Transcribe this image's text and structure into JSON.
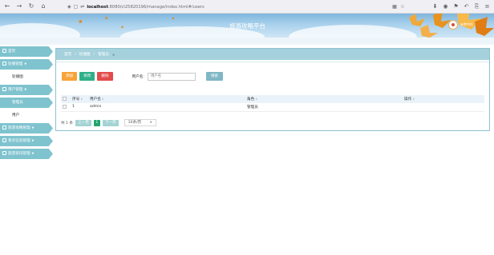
{
  "browser": {
    "back_icon": "arrow-left-icon",
    "forward_icon": "arrow-right-icon",
    "reload_icon": "reload-icon",
    "home_icon": "home-icon",
    "url_host": "localhost",
    "url_port_path": ":8080/cl25820196/manage/index.html#/users",
    "toolbar_icons": [
      "extensions-icon",
      "account-icon",
      "bookmark-icon",
      "undo-icon",
      "screenshot-icon",
      "menu-icon"
    ]
  },
  "header": {
    "title": "旅游攻略平台",
    "user_name": "admin"
  },
  "sidebar": {
    "items": [
      {
        "label": "首页",
        "type": "menu",
        "caret": false
      },
      {
        "label": "轮播管理",
        "type": "menu",
        "caret": true
      },
      {
        "label": "轮播图",
        "type": "sub",
        "active": false
      },
      {
        "label": "用户管理",
        "type": "menu",
        "caret": true
      },
      {
        "label": "管理员",
        "type": "sub",
        "active": true
      },
      {
        "label": "用户",
        "type": "sub",
        "active": false
      },
      {
        "label": "旅游攻略管理",
        "type": "menu",
        "caret": true
      },
      {
        "label": "景点信息管理",
        "type": "menu",
        "caret": true
      },
      {
        "label": "旅游资讯管理",
        "type": "menu",
        "caret": true
      }
    ]
  },
  "breadcrumb": {
    "home": "首页",
    "section": "轮播图",
    "current": "管理员"
  },
  "toolbar": {
    "add_label": "添加",
    "edit_label": "修改",
    "delete_label": "删除",
    "search_label": "用户名:",
    "search_placeholder": "用户名",
    "search_button": "搜索"
  },
  "table": {
    "columns": [
      "序号",
      "用户名",
      "角色",
      "操作"
    ],
    "rows": [
      {
        "index": "1",
        "username": "admin",
        "role": "管理员",
        "action": ""
      }
    ]
  },
  "pager": {
    "total_text": "共 1 条",
    "prev_label": "上一页",
    "page": "1",
    "next_label": "下一页",
    "page_size": "10条/页"
  },
  "colors": {
    "accent": "#7fc3cf",
    "add": "#f7a33a",
    "edit": "#2fb08a",
    "delete": "#e34b4b",
    "current_page": "#21a56f"
  }
}
